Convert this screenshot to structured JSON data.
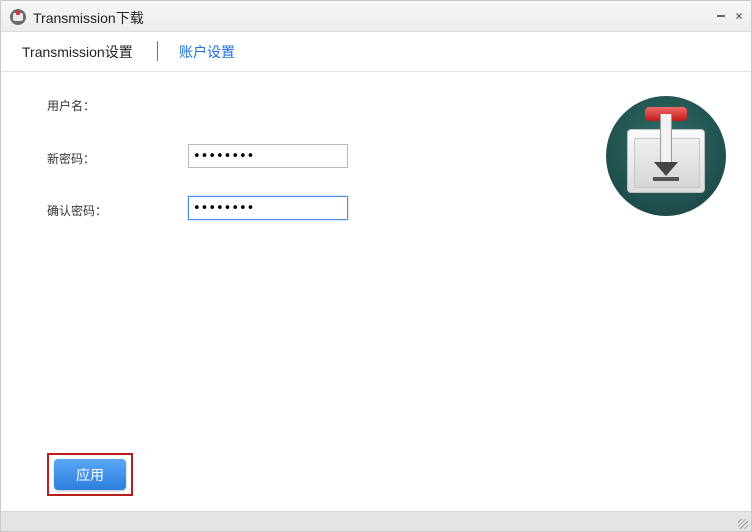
{
  "window": {
    "title": "Transmission下载",
    "icon": "transmission-app-icon",
    "close_glyph": "×"
  },
  "tabs": [
    {
      "label": "Transmission设置",
      "active": false
    },
    {
      "label": "账户设置",
      "active": true
    }
  ],
  "form": {
    "username_label": "用户名：",
    "new_password_label": "新密码：",
    "new_password_value": "11111111",
    "confirm_password_label": "确认密码：",
    "confirm_password_value": "11111111"
  },
  "actions": {
    "apply_label": "应用"
  },
  "colors": {
    "accent": "#1f6fd6",
    "apply_button": "#2d7fe0",
    "highlight_outline": "#b81c1c",
    "logo_background": "#1d4b48"
  }
}
